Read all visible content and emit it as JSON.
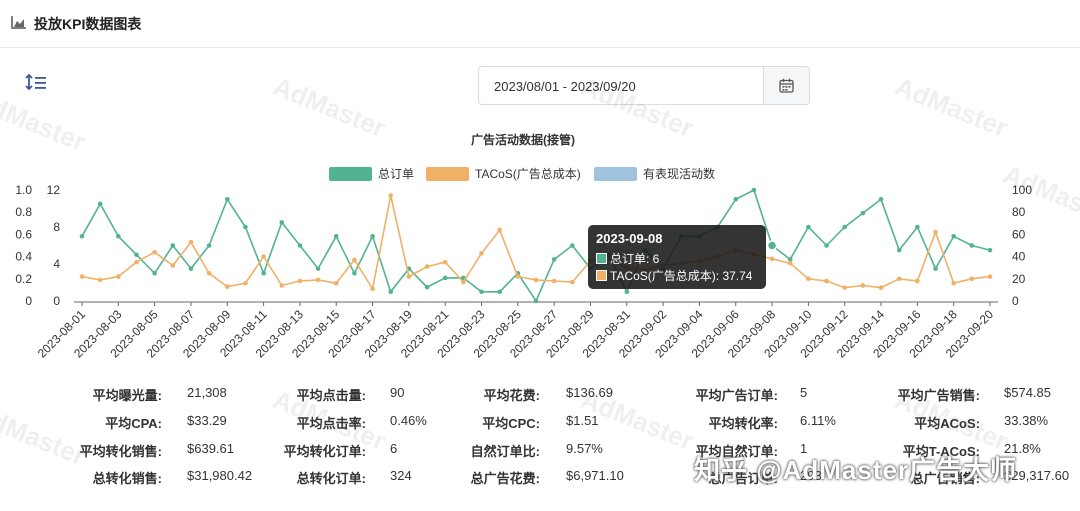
{
  "header": {
    "title": "投放KPI数据图表"
  },
  "date_range": {
    "value": "2023/08/01 - 2023/09/20"
  },
  "watermarks": [
    "AdMaster",
    "AdMaster",
    "AdMaster",
    "AdMaster",
    "AdMaster",
    "AdMaster",
    "AdMaster",
    "AdMaster",
    "AdMaster"
  ],
  "chart_data": {
    "type": "line",
    "title": "广告活动数据(接管)",
    "legend": [
      "总订单",
      "TACoS(广告总成本)",
      "有表现活动数"
    ],
    "legend_placement": "top-center",
    "colors": {
      "orders": "#52b393",
      "tacos": "#f0b065",
      "active": "#9fc3de"
    },
    "x": [
      "2023-08-01",
      "2023-08-02",
      "2023-08-03",
      "2023-08-04",
      "2023-08-05",
      "2023-08-06",
      "2023-08-07",
      "2023-08-08",
      "2023-08-09",
      "2023-08-10",
      "2023-08-11",
      "2023-08-12",
      "2023-08-13",
      "2023-08-14",
      "2023-08-15",
      "2023-08-16",
      "2023-08-17",
      "2023-08-18",
      "2023-08-19",
      "2023-08-20",
      "2023-08-21",
      "2023-08-22",
      "2023-08-23",
      "2023-08-24",
      "2023-08-25",
      "2023-08-26",
      "2023-08-27",
      "2023-08-28",
      "2023-08-29",
      "2023-08-30",
      "2023-08-31",
      "2023-09-01",
      "2023-09-02",
      "2023-09-03",
      "2023-09-04",
      "2023-09-05",
      "2023-09-06",
      "2023-09-07",
      "2023-09-08",
      "2023-09-09",
      "2023-09-10",
      "2023-09-11",
      "2023-09-12",
      "2023-09-13",
      "2023-09-14",
      "2023-09-15",
      "2023-09-16",
      "2023-09-17",
      "2023-09-18",
      "2023-09-19",
      "2023-09-20"
    ],
    "x_tick_labels": [
      "2023-08-01",
      "2023-08-03",
      "2023-08-05",
      "2023-08-07",
      "2023-08-09",
      "2023-08-11",
      "2023-08-13",
      "2023-08-15",
      "2023-08-17",
      "2023-08-19",
      "2023-08-21",
      "2023-08-23",
      "2023-08-25",
      "2023-08-27",
      "2023-08-29",
      "2023-08-31",
      "2023-09-02",
      "2023-09-04",
      "2023-09-06",
      "2023-09-08",
      "2023-09-10",
      "2023-09-12",
      "2023-09-14",
      "2023-09-16",
      "2023-09-18",
      "2023-09-20"
    ],
    "series": [
      {
        "name": "总订单",
        "axis": "left-inner",
        "values": [
          7,
          10.5,
          7,
          5,
          3,
          6,
          3.5,
          6,
          11,
          8,
          3,
          8.5,
          6,
          3.5,
          7,
          3,
          7,
          1,
          3.5,
          1.5,
          2.5,
          2.5,
          1,
          1,
          3,
          0,
          4.5,
          6,
          3.5,
          5,
          1,
          5.5,
          3.5,
          7,
          7,
          8,
          11,
          12,
          6,
          4.5,
          8,
          6,
          8,
          9.5,
          11,
          5.5,
          8,
          3.5,
          7,
          6,
          5.5
        ]
      },
      {
        "name": "TACoS(广告总成本)",
        "axis": "right",
        "values": [
          22,
          19,
          22,
          35,
          44,
          32,
          53,
          25,
          13,
          16,
          40,
          14,
          18,
          19,
          16,
          37,
          11,
          95,
          22,
          31,
          35,
          17,
          43,
          64,
          22,
          19,
          18,
          17,
          36,
          38,
          30,
          28,
          32,
          34,
          36,
          40,
          46,
          42,
          38,
          34,
          20,
          18,
          12,
          14,
          12,
          20,
          18,
          62,
          16,
          20,
          22
        ]
      },
      {
        "name": "有表现活动数",
        "axis": "left",
        "values": []
      }
    ],
    "y_left_outer_ticks": [
      "1.0",
      "0.8",
      "0.6",
      "0.4",
      "0.2",
      "0"
    ],
    "y_left_outer_range": [
      0,
      1.0
    ],
    "y_left_inner_ticks": [
      "12",
      "8",
      "4",
      "0"
    ],
    "y_left_inner_range": [
      0,
      12
    ],
    "y_right_ticks": [
      "100",
      "80",
      "60",
      "40",
      "20",
      "0"
    ],
    "y_right_range": [
      0,
      100
    ],
    "grid": false,
    "tooltip": {
      "date": "2023-09-08",
      "orders_text": "总订单: 6",
      "tacos_text": "TACoS(广告总成本): 37.74"
    }
  },
  "stats": [
    {
      "label": "平均曝光量:",
      "value": "21,308"
    },
    {
      "label": "平均点击量:",
      "value": "90"
    },
    {
      "label": "平均花费:",
      "value": "$136.69"
    },
    {
      "label": "平均广告订单:",
      "value": "5"
    },
    {
      "label": "平均广告销售:",
      "value": "$574.85"
    },
    {
      "label": "平均CPA:",
      "value": "$33.29"
    },
    {
      "label": "平均点击率:",
      "value": "0.46%"
    },
    {
      "label": "平均CPC:",
      "value": "$1.51"
    },
    {
      "label": "平均转化率:",
      "value": "6.11%"
    },
    {
      "label": "平均ACoS:",
      "value": "33.38%"
    },
    {
      "label": "平均转化销售:",
      "value": "$639.61"
    },
    {
      "label": "平均转化订单:",
      "value": "6"
    },
    {
      "label": "自然订单比:",
      "value": "9.57%"
    },
    {
      "label": "平均自然订单:",
      "value": "1"
    },
    {
      "label": "平均T-ACoS:",
      "value": "21.8%"
    },
    {
      "label": "总转化销售:",
      "value": "$31,980.42"
    },
    {
      "label": "总转化订单:",
      "value": "324"
    },
    {
      "label": "总广告花费:",
      "value": "$6,971.10"
    },
    {
      "label": "总广告订单:",
      "value": "293"
    },
    {
      "label": "总广告销售:",
      "value": "$29,317.60"
    }
  ],
  "credit_watermark": "知乎 @AdMaster广告大师"
}
